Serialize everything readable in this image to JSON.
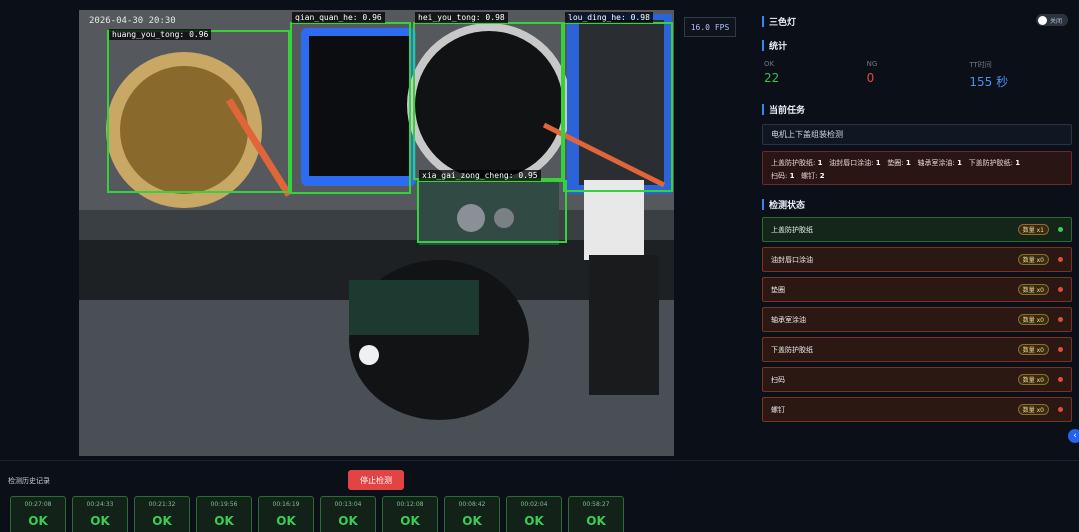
{
  "camera": {
    "timestamp": "2026-04-30 20:30",
    "fps": "16.0 FPS",
    "detections": [
      {
        "label": "huang_you_tong: 0.96"
      },
      {
        "label": "qian_quan_he: 0.96"
      },
      {
        "label": "hei_you_tong: 0.98"
      },
      {
        "label": "lou_ding_he: 0.98"
      },
      {
        "label": "xia_gai_zong_cheng: 0.95"
      }
    ]
  },
  "panel": {
    "light_title": "三色灯",
    "light_toggle": "关闭",
    "stats_title": "统计",
    "stats": [
      {
        "key": "OK",
        "value": "22",
        "color": "#3cbc57"
      },
      {
        "key": "NG",
        "value": "0",
        "color": "#e24d3b"
      },
      {
        "key": "TT时间",
        "value": "155 秒",
        "color": "#4d8ff0"
      }
    ],
    "task_title": "当前任务",
    "task_name": "电机上下盖组装检测",
    "requirements": [
      {
        "name": "上盖防护胶纸:",
        "count": "1"
      },
      {
        "name": "油封唇口涂油:",
        "count": "1"
      },
      {
        "name": "垫圈:",
        "count": "1"
      },
      {
        "name": "轴承室涂油:",
        "count": "1"
      },
      {
        "name": "下盖防护胶纸:",
        "count": "1"
      },
      {
        "name": "扫码:",
        "count": "1"
      },
      {
        "name": "螺钉:",
        "count": "2"
      }
    ],
    "status_title": "检测状态",
    "status_items": [
      {
        "label": "上盖防护胶纸",
        "count": "数量 x1",
        "state": "ok"
      },
      {
        "label": "油封唇口涂油",
        "count": "数量 x0",
        "state": "ng"
      },
      {
        "label": "垫圈",
        "count": "数量 x0",
        "state": "ng"
      },
      {
        "label": "轴承室涂油",
        "count": "数量 x0",
        "state": "ng"
      },
      {
        "label": "下盖防护胶纸",
        "count": "数量 x0",
        "state": "ng"
      },
      {
        "label": "扫码",
        "count": "数量 x0",
        "state": "ng"
      },
      {
        "label": "螺钉",
        "count": "数量 x0",
        "state": "ng"
      }
    ]
  },
  "history": {
    "title": "检测历史记录",
    "stop_label": "停止检测",
    "records": [
      {
        "time": "00:27:08",
        "result": "OK"
      },
      {
        "time": "00:24:33",
        "result": "OK"
      },
      {
        "time": "00:21:32",
        "result": "OK"
      },
      {
        "time": "00:19:56",
        "result": "OK"
      },
      {
        "time": "00:16:19",
        "result": "OK"
      },
      {
        "time": "00:13:04",
        "result": "OK"
      },
      {
        "time": "00:12:08",
        "result": "OK"
      },
      {
        "time": "00:08:42",
        "result": "OK"
      },
      {
        "time": "00:02:04",
        "result": "OK"
      },
      {
        "time": "00:58:27",
        "result": "OK"
      }
    ]
  }
}
